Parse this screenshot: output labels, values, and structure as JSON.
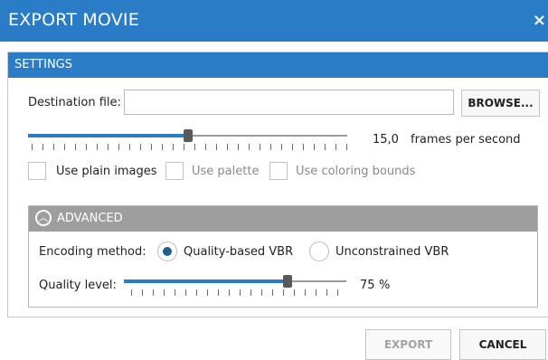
{
  "dialog": {
    "title": "EXPORT MOVIE",
    "close_glyph": "×",
    "accent_color": "#2b7cc6"
  },
  "settings": {
    "section_title": "SETTINGS",
    "destination_label": "Destination file:",
    "destination_value": "",
    "browse_label": "BROWSE...",
    "fps_value": "15,0",
    "fps_unit": "frames per second",
    "fps_fraction": 0.48,
    "checkboxes": [
      {
        "label": "Use plain images",
        "checked": false,
        "enabled": true
      },
      {
        "label": "Use palette",
        "checked": false,
        "enabled": false
      },
      {
        "label": "Use coloring bounds",
        "checked": false,
        "enabled": false
      }
    ]
  },
  "advanced": {
    "section_title": "ADVANCED",
    "expanded": true,
    "encoding_label": "Encoding method:",
    "encoding_options": [
      {
        "label": "Quality-based VBR",
        "selected": true
      },
      {
        "label": "Unconstrained VBR",
        "selected": false
      }
    ],
    "quality_label": "Quality level:",
    "quality_value": "75",
    "quality_unit": "%"
  },
  "footer": {
    "export_label": "EXPORT",
    "export_enabled": false,
    "cancel_label": "CANCEL"
  }
}
